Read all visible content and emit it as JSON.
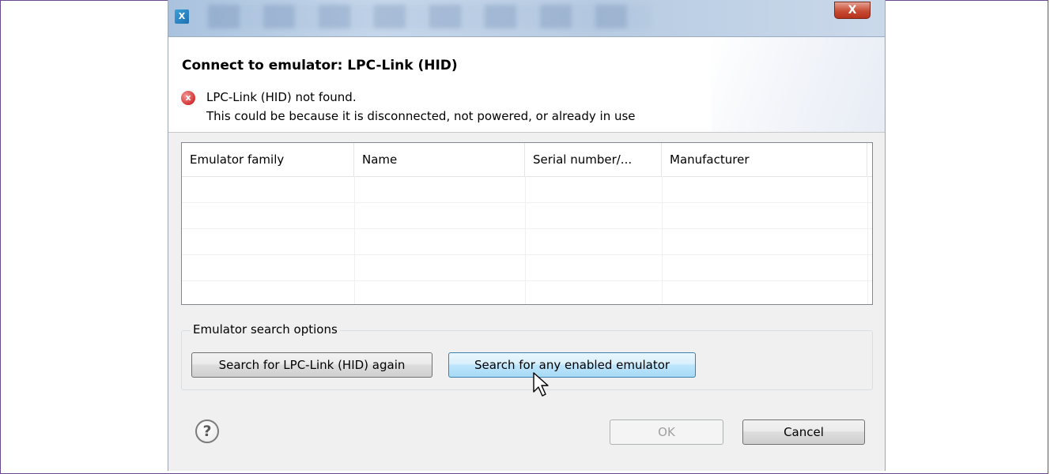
{
  "dialog": {
    "close_glyph": "X",
    "app_icon_label": "X",
    "header": {
      "title": "Connect to emulator: LPC-Link (HID)",
      "error_icon": "error-x-icon",
      "error_glyph": "x",
      "error_line1": "LPC-Link (HID) not found.",
      "error_line2": "This could be because it is disconnected, not powered, or already in use"
    },
    "table": {
      "columns": [
        "Emulator family",
        "Name",
        "Serial number/...",
        "Manufacturer"
      ],
      "rows": []
    },
    "search_group": {
      "label": "Emulator search options",
      "search_again_label": "Search for LPC-Link (HID) again",
      "search_any_label": "Search for any enabled emulator"
    },
    "footer": {
      "help_glyph": "?",
      "ok_label": "OK",
      "cancel_label": "Cancel"
    }
  },
  "colors": {
    "titlebar": "#b7cbe2",
    "close_button": "#c84b33",
    "error_icon": "#d63030",
    "hover_button": "#bee6fd",
    "outer_frame": "#6a4a8c"
  }
}
